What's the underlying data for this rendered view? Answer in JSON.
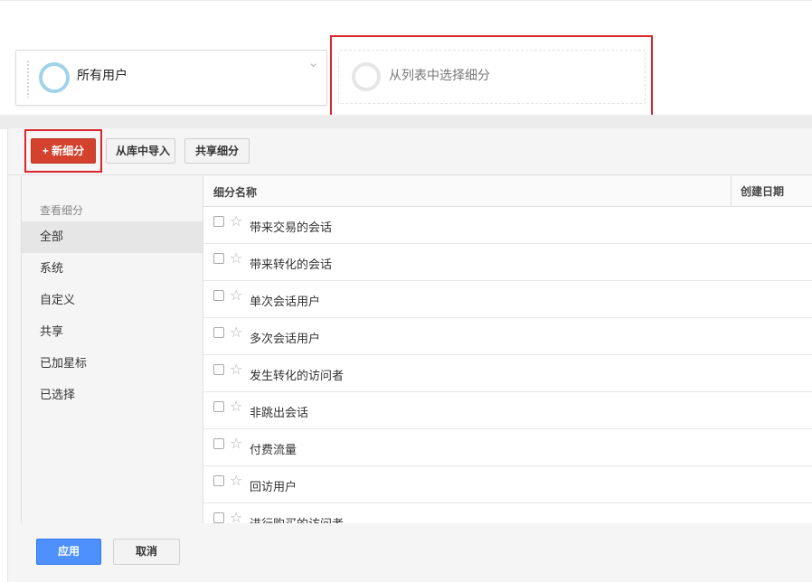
{
  "segments": {
    "current": {
      "label": "所有用户",
      "ring_color": "#9fd3ea"
    },
    "placeholder": {
      "label": "从列表中选择细分"
    }
  },
  "toolbar": {
    "new_label": "+ 新细分",
    "import_label": "从库中导入",
    "share_label": "共享细分"
  },
  "sidebar": {
    "heading": "查看细分",
    "items": [
      {
        "label": "全部",
        "active": true
      },
      {
        "label": "系统"
      },
      {
        "label": "自定义"
      },
      {
        "label": "共享"
      },
      {
        "label": "已加星标"
      },
      {
        "label": "已选择"
      }
    ]
  },
  "table": {
    "columns": {
      "name": "细分名称",
      "date": "创建日期"
    },
    "rows": [
      {
        "name": "带来交易的会话"
      },
      {
        "name": "带来转化的会话"
      },
      {
        "name": "单次会话用户"
      },
      {
        "name": "多次会话用户"
      },
      {
        "name": "发生转化的访问者"
      },
      {
        "name": "非跳出会话"
      },
      {
        "name": "付费流量"
      },
      {
        "name": "回访用户"
      },
      {
        "name": "进行购买的访问者"
      }
    ]
  },
  "footer": {
    "apply_label": "应用",
    "cancel_label": "取消"
  },
  "colors": {
    "new_button": "#d4412d",
    "apply_button": "#4d90fe",
    "highlight_box": "#d9262d"
  }
}
